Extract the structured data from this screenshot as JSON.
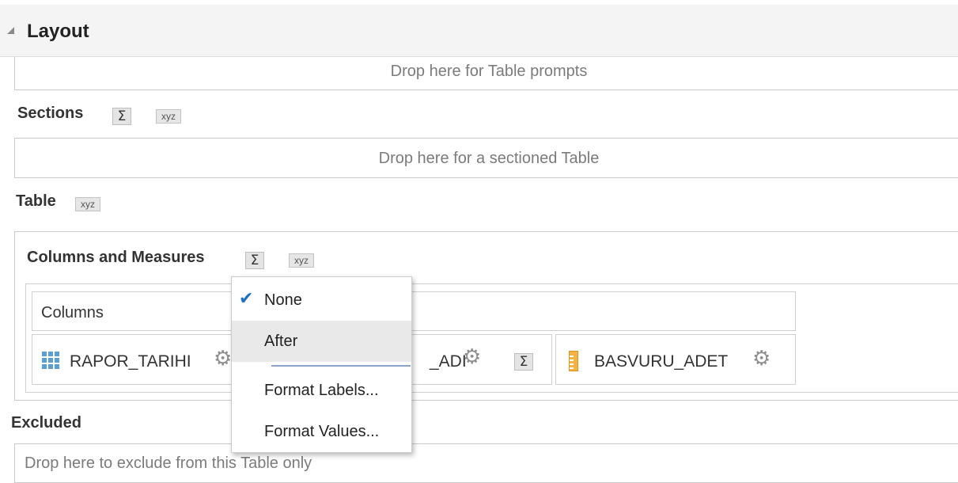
{
  "header": {
    "title": "Layout"
  },
  "prompts": {
    "drop_text": "Drop here for Table prompts"
  },
  "sections": {
    "label": "Sections",
    "sigma": "Σ",
    "xyz": "xyz",
    "drop_text": "Drop here for a sectioned Table"
  },
  "table": {
    "label": "Table",
    "xyz": "xyz"
  },
  "columns_measures": {
    "label": "Columns and Measures",
    "sigma": "Σ",
    "xyz": "xyz"
  },
  "columns": {
    "header_label": "Columns",
    "items": [
      {
        "name": "RAPOR_TARIHI",
        "icon": "grid-icon"
      },
      {
        "name": "_ADI",
        "icon": "none"
      },
      {
        "name": "BASVURU_ADET",
        "icon": "ruler-icon"
      }
    ],
    "sigma": "Σ"
  },
  "menu": {
    "items": [
      {
        "label": "None",
        "checked": true
      },
      {
        "label": "After",
        "checked": false
      },
      {
        "label": "Format Labels...",
        "checked": false
      },
      {
        "label": "Format Values...",
        "checked": false
      }
    ]
  },
  "excluded": {
    "label": "Excluded",
    "drop_text": "Drop here to exclude from this Table only"
  },
  "icons": {
    "check": "✔",
    "gear": "⚙"
  },
  "colors": {
    "check_accent": "#1e6fc5",
    "grid_icon": "#5a9fd4",
    "ruler_icon": "#f4b342",
    "gear": "#8e8e8e"
  }
}
